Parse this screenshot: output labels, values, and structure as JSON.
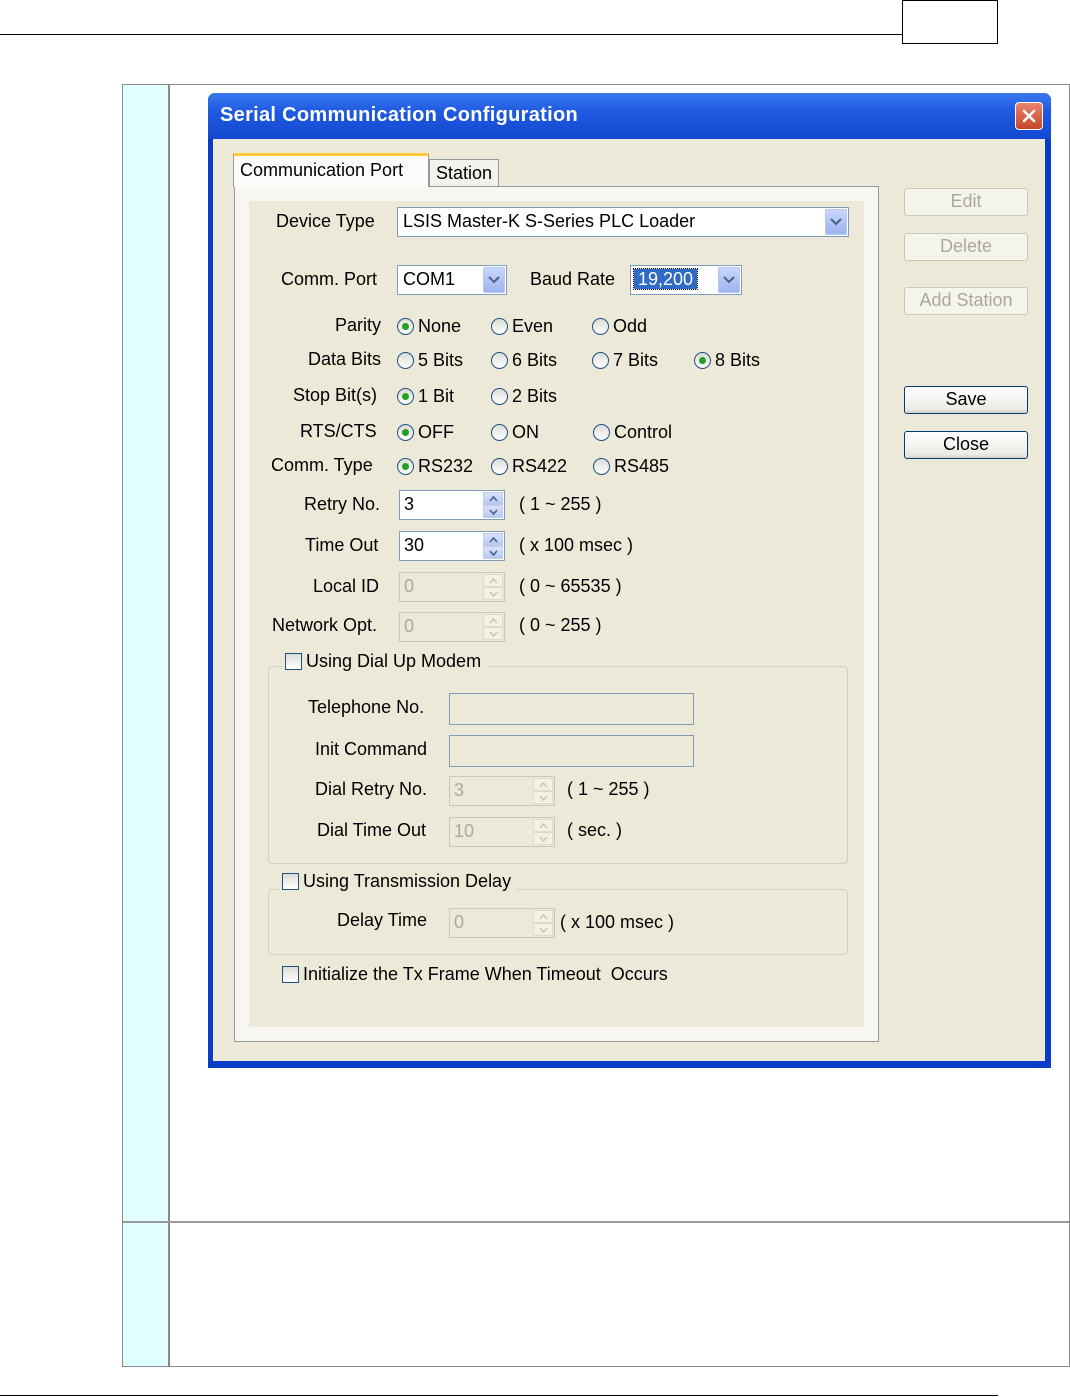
{
  "dialog": {
    "title": "Serial Communication Configuration",
    "tabs": [
      {
        "label": "Communication Port",
        "active": true
      },
      {
        "label": "Station",
        "active": false
      }
    ]
  },
  "buttons": {
    "edit": {
      "label": "Edit",
      "enabled": false
    },
    "delete": {
      "label": "Delete",
      "enabled": false
    },
    "add_station": {
      "label": "Add Station",
      "enabled": false
    },
    "save": {
      "label": "Save",
      "enabled": true
    },
    "close": {
      "label": "Close",
      "enabled": true
    }
  },
  "form": {
    "device_type": {
      "label": "Device Type",
      "value": "LSIS Master-K S-Series PLC Loader"
    },
    "comm_port": {
      "label": "Comm. Port",
      "value": "COM1"
    },
    "baud_rate": {
      "label": "Baud Rate",
      "value": "19,200"
    },
    "parity": {
      "label": "Parity",
      "options": [
        "None",
        "Even",
        "Odd"
      ],
      "selected": "None"
    },
    "data_bits": {
      "label": "Data Bits",
      "options": [
        "5 Bits",
        "6 Bits",
        "7 Bits",
        "8 Bits"
      ],
      "selected": "8 Bits"
    },
    "stop_bits": {
      "label": "Stop Bit(s)",
      "options": [
        "1 Bit",
        "2 Bits"
      ],
      "selected": "1 Bit"
    },
    "rts_cts": {
      "label": "RTS/CTS",
      "options": [
        "OFF",
        "ON",
        "Control"
      ],
      "selected": "OFF"
    },
    "comm_type": {
      "label": "Comm. Type",
      "options": [
        "RS232",
        "RS422",
        "RS485"
      ],
      "selected": "RS232"
    },
    "retry_no": {
      "label": "Retry No.",
      "value": "3",
      "hint": "( 1 ~ 255 )"
    },
    "time_out": {
      "label": "Time Out",
      "value": "30",
      "hint": "( x 100 msec )"
    },
    "local_id": {
      "label": "Local ID",
      "value": "0",
      "hint": "( 0 ~ 65535 )",
      "enabled": false
    },
    "network_opt": {
      "label": "Network Opt.",
      "value": "0",
      "hint": "( 0 ~ 255 )",
      "enabled": false
    },
    "dial_up": {
      "label": "Using Dial Up Modem",
      "checked": false,
      "telephone_label": "Telephone No.",
      "telephone_value": "",
      "init_label": "Init Command",
      "init_value": "",
      "dial_retry_label": "Dial Retry No.",
      "dial_retry_value": "3",
      "dial_retry_hint": "( 1 ~ 255 )",
      "dial_timeout_label": "Dial Time Out",
      "dial_timeout_value": "10",
      "dial_timeout_hint": "( sec. )"
    },
    "tx_delay": {
      "label": "Using Transmission Delay",
      "checked": false,
      "delay_label": "Delay Time",
      "delay_value": "0",
      "delay_hint": "( x 100 msec )"
    },
    "init_tx": {
      "label": "Initialize the Tx Frame When Timeout  Occurs",
      "checked": false
    }
  },
  "colors": {
    "title_bar": "#1f5ae0",
    "dialog_bg": "#ece9d8",
    "sidebar_cyan": "#e0ffff",
    "radio_on": "#21a121"
  },
  "icons": {
    "close": "close-icon",
    "dropdown": "chevron-down-icon",
    "spin": "spin-arrows-icon"
  }
}
